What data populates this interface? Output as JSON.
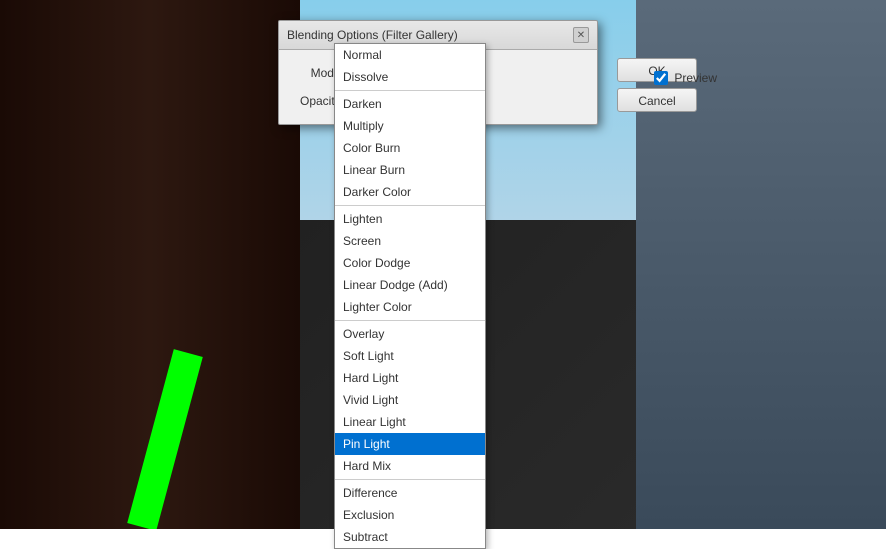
{
  "dialog": {
    "title": "Blending Options (Filter Gallery)",
    "close_label": "✕"
  },
  "mode_label": "Mode:",
  "opacity_label": "Opacity:",
  "selected_mode": "Pin Light",
  "ok_label": "OK",
  "cancel_label": "Cancel",
  "preview_label": "Preview",
  "dropdown": {
    "groups": [
      {
        "items": [
          {
            "label": "Normal",
            "selected": false
          },
          {
            "label": "Dissolve",
            "selected": false
          }
        ]
      },
      {
        "items": [
          {
            "label": "Darken",
            "selected": false
          },
          {
            "label": "Multiply",
            "selected": false
          },
          {
            "label": "Color Burn",
            "selected": false
          },
          {
            "label": "Linear Burn",
            "selected": false
          },
          {
            "label": "Darker Color",
            "selected": false
          }
        ]
      },
      {
        "items": [
          {
            "label": "Lighten",
            "selected": false
          },
          {
            "label": "Screen",
            "selected": false
          },
          {
            "label": "Color Dodge",
            "selected": false
          },
          {
            "label": "Linear Dodge (Add)",
            "selected": false
          },
          {
            "label": "Lighter Color",
            "selected": false
          }
        ]
      },
      {
        "items": [
          {
            "label": "Overlay",
            "selected": false
          },
          {
            "label": "Soft Light",
            "selected": false
          },
          {
            "label": "Hard Light",
            "selected": false
          },
          {
            "label": "Vivid Light",
            "selected": false
          },
          {
            "label": "Linear Light",
            "selected": false
          },
          {
            "label": "Pin Light",
            "selected": true
          },
          {
            "label": "Hard Mix",
            "selected": false
          }
        ]
      },
      {
        "items": [
          {
            "label": "Difference",
            "selected": false
          },
          {
            "label": "Exclusion",
            "selected": false
          },
          {
            "label": "Subtract",
            "selected": false
          }
        ]
      }
    ]
  },
  "colors": {
    "selected_bg": "#0070d0",
    "selected_text": "#ffffff",
    "dialog_bg": "#f0f0f0"
  }
}
